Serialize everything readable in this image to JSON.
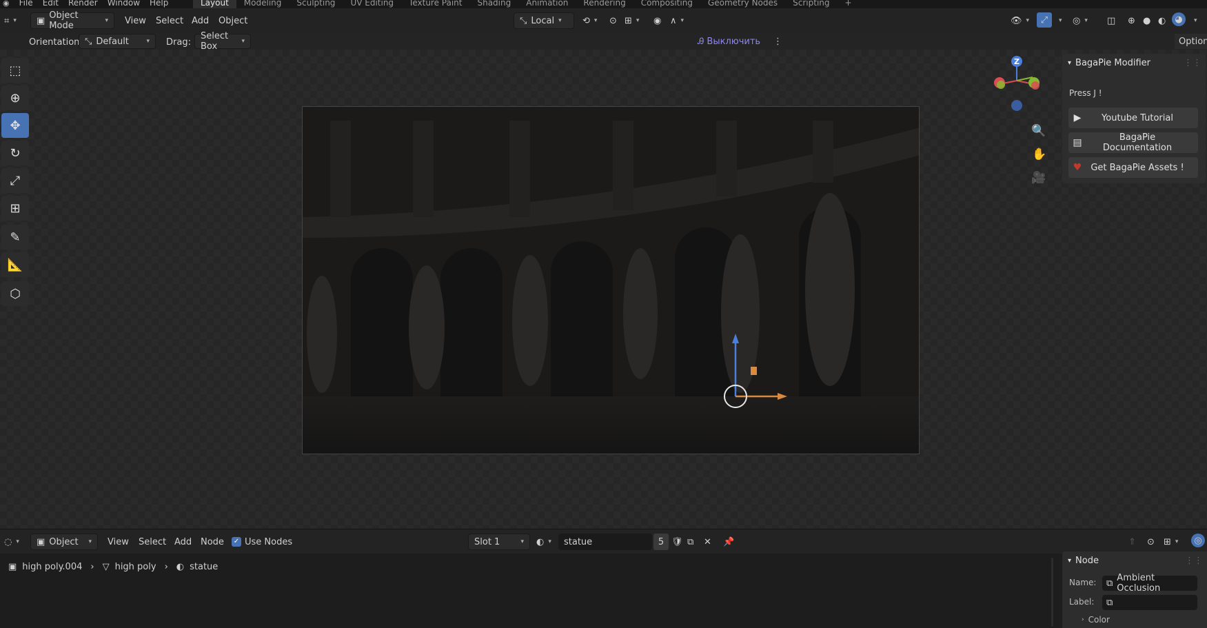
{
  "topbar": {
    "menus": [
      "File",
      "Edit",
      "Render",
      "Window",
      "Help"
    ],
    "workspaces": [
      "Layout",
      "Modeling",
      "Sculpting",
      "UV Editing",
      "Texture Paint",
      "Shading",
      "Animation",
      "Rendering",
      "Compositing",
      "Geometry Nodes",
      "Scripting"
    ],
    "active_workspace": "Layout",
    "add_tab": "+"
  },
  "header": {
    "mode": "Object Mode",
    "menus": [
      "View",
      "Select",
      "Add",
      "Object"
    ],
    "transform_orientation": "Local"
  },
  "toolsettings": {
    "orientation_label": "Orientation:",
    "orientation_value": "Default",
    "drag_label": "Drag:",
    "drag_value": "Select Box",
    "translate_toggle": "Выключить",
    "options": "Options"
  },
  "gizmo": {
    "z": "Z"
  },
  "bagapie": {
    "title": "BagaPie Modifier",
    "hint": "Press J !",
    "buttons": [
      "Youtube Tutorial",
      "BagaPie Documentation",
      "Get BagaPie Assets !"
    ],
    "heart_color": "#c0392b"
  },
  "node_editor": {
    "type": "Object",
    "menus": [
      "View",
      "Select",
      "Add",
      "Node"
    ],
    "use_nodes": "Use Nodes",
    "slot": "Slot 1",
    "material": "statue",
    "users": "5",
    "breadcrumb": [
      "high poly.004",
      "high poly",
      "statue"
    ]
  },
  "node_panel": {
    "title": "Node",
    "name_label": "Name:",
    "name_value": "Ambient Occlusion",
    "label_label": "Label:",
    "label_value": "",
    "color_section": "Color"
  },
  "colors": {
    "accent": "#4772b3",
    "x_axis": "#d94e52",
    "y_axis": "#88b830",
    "z_axis": "#4a7fdc"
  }
}
